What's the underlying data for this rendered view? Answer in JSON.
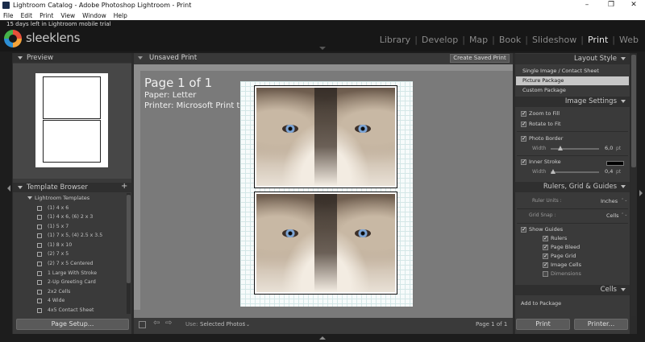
{
  "window": {
    "title": "Lightroom Catalog - Adobe Photoshop Lightroom - Print",
    "controls": [
      "–",
      "❐",
      "✕"
    ]
  },
  "menu": [
    "File",
    "Edit",
    "Print",
    "View",
    "Window",
    "Help"
  ],
  "trial_notice": "15 days left in Lightroom mobile trial",
  "brand": {
    "logo_text": "sleeklens",
    "logo_colors": [
      "#e8503a",
      "#f2a33a",
      "#2d8fd5",
      "#45b34a"
    ]
  },
  "modules": {
    "items": [
      "Library",
      "Develop",
      "Map",
      "Book",
      "Slideshow",
      "Print",
      "Web"
    ],
    "active": "Print"
  },
  "left_panel": {
    "preview_title": "Preview",
    "template_browser_title": "Template Browser",
    "add_symbol": "+",
    "folder": "Lightroom Templates",
    "templates": [
      "(1) 4 x 6",
      "(1) 4 x 6, (6) 2 x 3",
      "(1) 5 x 7",
      "(1) 7 x 5, (4) 2.5 x 3.5",
      "(1) 8 x 10",
      "(2) 7 x 5",
      "(2) 7 x 5 Centered",
      "1 Large With Stroke",
      "2-Up Greeting Card",
      "2x2 Cells",
      "4 Wide",
      "4x5 Contact Sheet"
    ],
    "page_setup": "Page Setup..."
  },
  "center": {
    "doc_title": "Unsaved Print",
    "create_button": "Create Saved Print",
    "page_info": {
      "page": "Page 1 of 1",
      "paper": "Paper:  Letter",
      "printer": "Printer:  Microsoft Print to PDF"
    },
    "use_label": "Use:",
    "use_value": "Selected Photos",
    "page_counter": "Page 1 of 1"
  },
  "right_panel": {
    "layout_style": {
      "title": "Layout Style",
      "options": [
        "Single Image / Contact Sheet",
        "Picture Package",
        "Custom Package"
      ],
      "selected": "Picture Package"
    },
    "image_settings": {
      "title": "Image Settings",
      "zoom_to_fill": "Zoom to Fill",
      "rotate_to_fit": "Rotate to Fit",
      "photo_border": "Photo Border",
      "border_width_label": "Width",
      "border_width_value": "6,0",
      "border_width_unit": "pt",
      "border_width_level": 0.2,
      "inner_stroke": "Inner Stroke",
      "stroke_width_label": "Width",
      "stroke_width_value": "0,4",
      "stroke_width_unit": "pt",
      "stroke_width_level": 0.05,
      "stroke_color": "#000000"
    },
    "rulers": {
      "title": "Rulers, Grid & Guides",
      "ruler_units_label": "Ruler Units :",
      "ruler_units_value": "Inches",
      "grid_snap_label": "Grid Snap :",
      "grid_snap_value": "Cells",
      "show_guides": "Show Guides",
      "guides": [
        {
          "label": "Rulers",
          "checked": true
        },
        {
          "label": "Page Bleed",
          "checked": true
        },
        {
          "label": "Page Grid",
          "checked": true
        },
        {
          "label": "Image Cells",
          "checked": true
        },
        {
          "label": "Dimensions",
          "checked": false
        }
      ]
    },
    "cells": {
      "title": "Cells",
      "add_to_package": "Add to Package"
    },
    "print_button": "Print",
    "printer_button": "Printer..."
  }
}
